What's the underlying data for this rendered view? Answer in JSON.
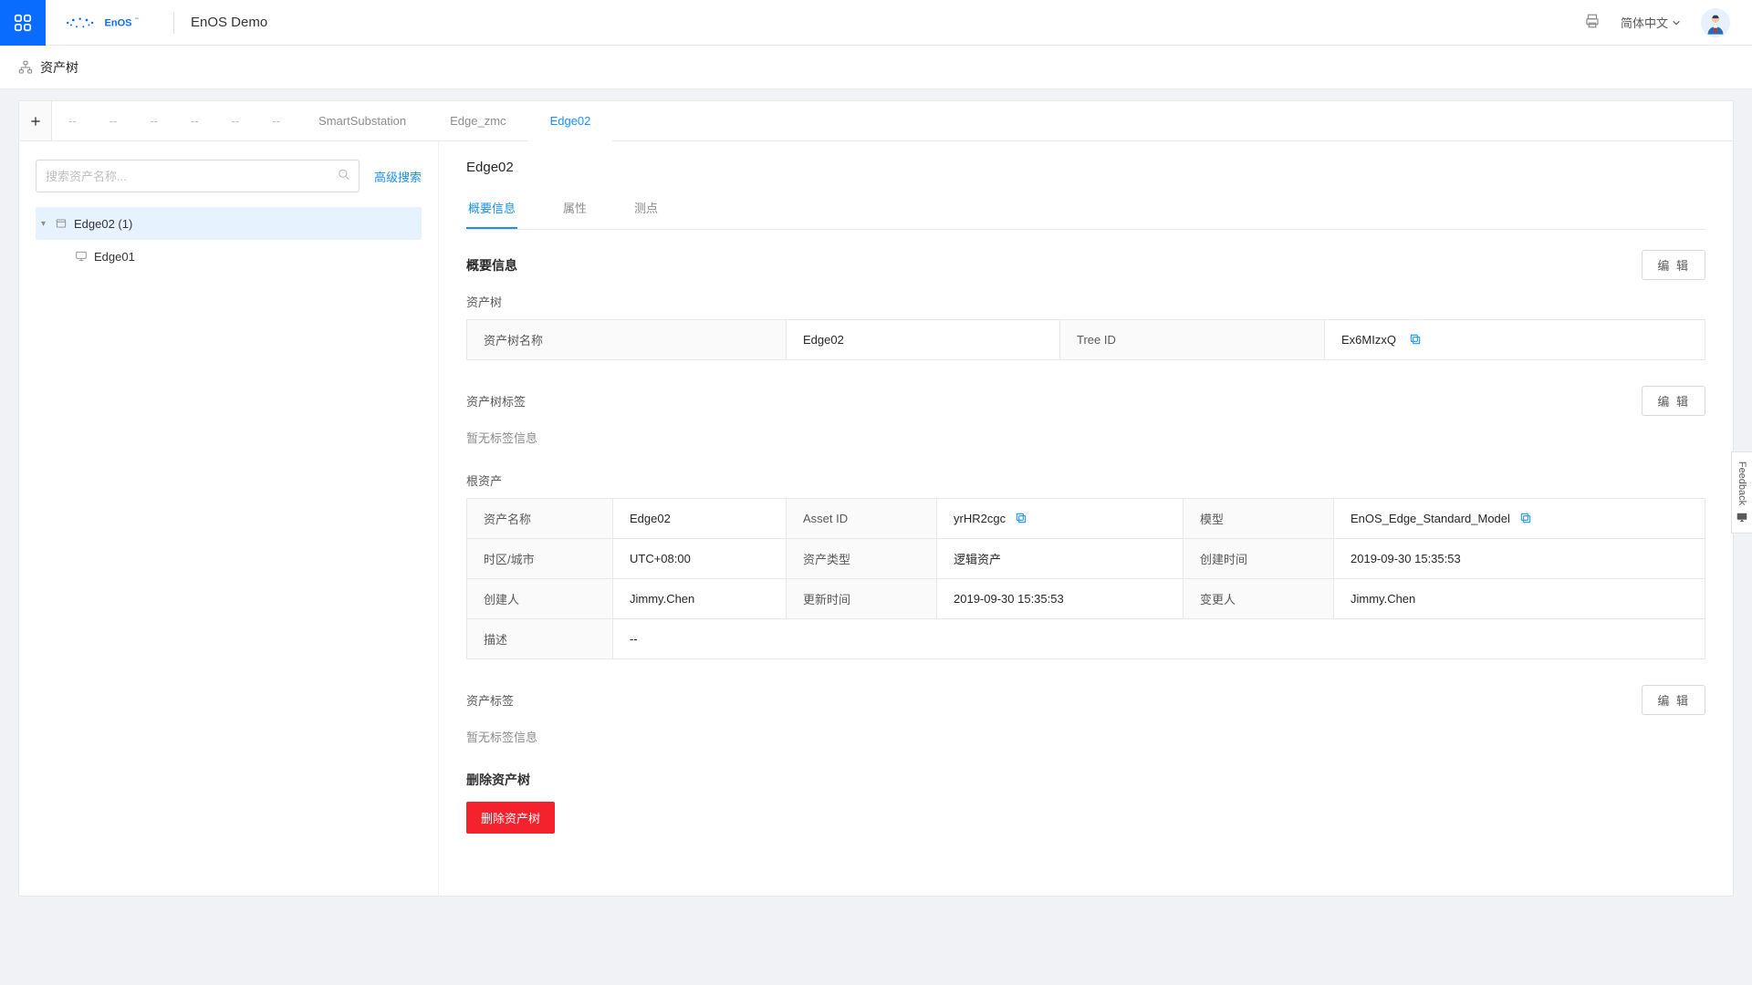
{
  "header": {
    "title": "EnOS Demo",
    "lang": "简体中文"
  },
  "subheader": {
    "label": "资产树"
  },
  "tabs": {
    "dashes": [
      "--",
      "--",
      "--",
      "--",
      "--",
      "--"
    ],
    "named": [
      {
        "label": "SmartSubstation",
        "active": false
      },
      {
        "label": "Edge_zmc",
        "active": false
      },
      {
        "label": "Edge02",
        "active": true
      }
    ]
  },
  "sidebar": {
    "search": {
      "placeholder": "搜索资产名称..."
    },
    "advanced": "高级搜索",
    "tree": [
      {
        "label": "Edge02 (1)",
        "selected": true,
        "expanded": true
      },
      {
        "label": "Edge01",
        "child": true
      }
    ]
  },
  "main": {
    "title": "Edge02",
    "tabs": [
      {
        "label": "概要信息",
        "active": true
      },
      {
        "label": "属性"
      },
      {
        "label": "测点"
      }
    ],
    "overview": {
      "heading": "概要信息",
      "edit": "编 辑",
      "asset_tree_label": "资产树",
      "rows": [
        {
          "k": "资产树名称",
          "v": "Edge02"
        },
        {
          "k": "Tree ID",
          "v": "Ex6MIzxQ",
          "copy": true
        }
      ]
    },
    "tree_tags": {
      "heading": "资产树标签",
      "edit": "编 辑",
      "empty": "暂无标签信息"
    },
    "root_asset": {
      "heading": "根资产",
      "rows": [
        [
          {
            "k": "资产名称",
            "v": "Edge02"
          },
          {
            "k": "Asset ID",
            "v": "yrHR2cgc",
            "copy": true
          },
          {
            "k": "模型",
            "v": "EnOS_Edge_Standard_Model",
            "copy": true
          }
        ],
        [
          {
            "k": "时区/城市",
            "v": "UTC+08:00"
          },
          {
            "k": "资产类型",
            "v": "逻辑资产"
          },
          {
            "k": "创建时间",
            "v": "2019-09-30 15:35:53"
          }
        ],
        [
          {
            "k": "创建人",
            "v": "Jimmy.Chen"
          },
          {
            "k": "更新时间",
            "v": "2019-09-30 15:35:53"
          },
          {
            "k": "变更人",
            "v": "Jimmy.Chen"
          }
        ],
        [
          {
            "k": "描述",
            "v": "--",
            "span": true
          }
        ]
      ]
    },
    "asset_tags": {
      "heading": "资产标签",
      "edit": "编 辑",
      "empty": "暂无标签信息"
    },
    "delete": {
      "heading": "删除资产树",
      "button": "删除资产树"
    }
  },
  "feedback": "Feedback"
}
